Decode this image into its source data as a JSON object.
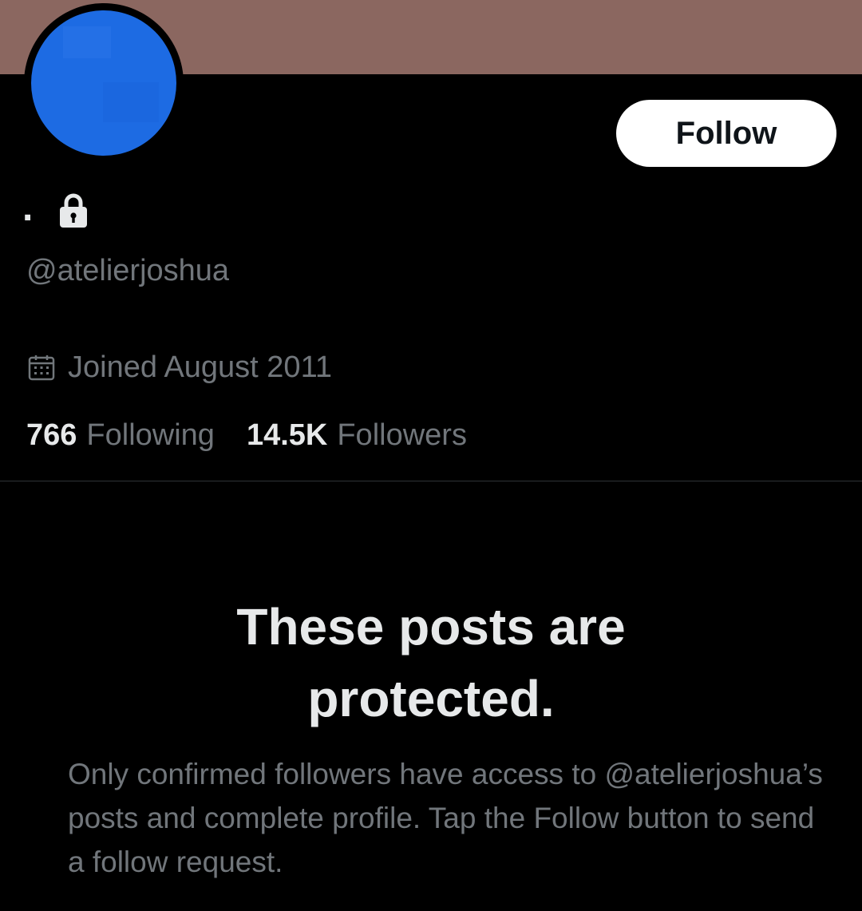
{
  "colors": {
    "banner": "#8b6760",
    "avatar": "#1d6be3",
    "background": "#000000",
    "primary_text": "#e7e9ea",
    "secondary_text": "#71767b",
    "follow_button_bg": "#ffffff",
    "divider": "#2f3336"
  },
  "profile": {
    "display_name": ".",
    "handle": "@atelierjoshua",
    "joined": "Joined August 2011",
    "protected_icon": "lock-icon",
    "joined_icon": "calendar-icon"
  },
  "actions": {
    "follow_label": "Follow"
  },
  "stats": {
    "following_count": "766",
    "following_label": "Following",
    "followers_count": "14.5K",
    "followers_label": "Followers"
  },
  "protected_notice": {
    "title": "These posts are protected.",
    "description": "Only confirmed followers have access to @atelierjoshua’s posts and complete profile. Tap the Follow button to send a follow request."
  }
}
